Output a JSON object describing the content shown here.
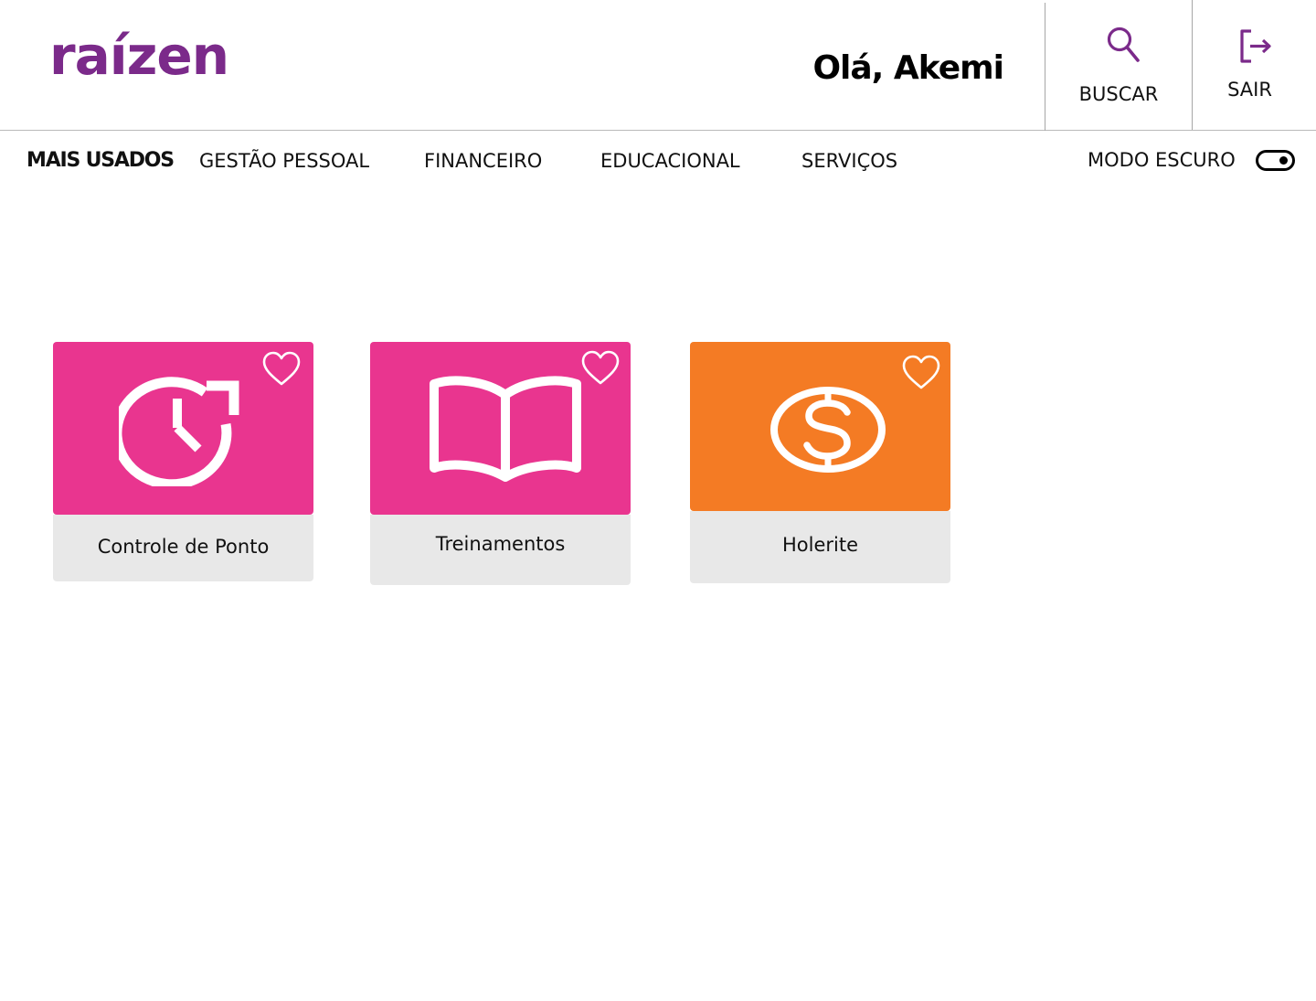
{
  "header": {
    "logo_text": "raízen",
    "greeting": "Olá, Akemi",
    "search_label": "BUSCAR",
    "logout_label": "SAIR"
  },
  "nav": {
    "items": [
      {
        "label": "MAIS USADOS",
        "active": true
      },
      {
        "label": "GESTÃO PESSOAL",
        "active": false
      },
      {
        "label": "FINANCEIRO",
        "active": false
      },
      {
        "label": "EDUCACIONAL",
        "active": false
      },
      {
        "label": "SERVIÇOS",
        "active": false
      }
    ],
    "dark_mode_label": "MODO ESCURO"
  },
  "cards": [
    {
      "label": "Controle de Ponto",
      "icon": "clock-refresh-icon",
      "color": "#e9358f"
    },
    {
      "label": "Treinamentos",
      "icon": "open-book-icon",
      "color": "#e9358f"
    },
    {
      "label": "Holerite",
      "icon": "dollar-coin-icon",
      "color": "#f47b24"
    }
  ],
  "colors": {
    "brand_purple": "#7b2a8a",
    "pink": "#e9358f",
    "orange": "#f47b24",
    "caption_gray": "#e8e8e8"
  }
}
